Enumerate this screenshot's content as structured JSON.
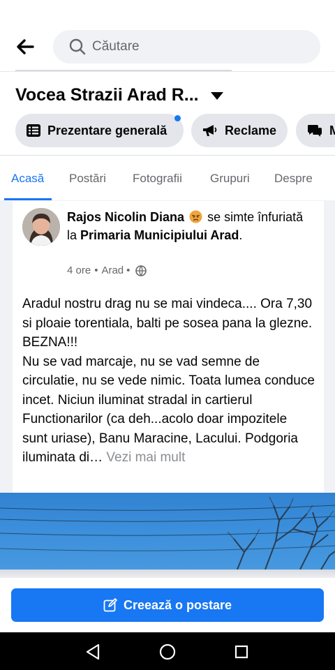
{
  "search": {
    "placeholder": "Căutare"
  },
  "page": {
    "title": "Vocea Strazii Arad R..."
  },
  "pills": [
    {
      "label": "Prezentare generală",
      "icon": "list-icon",
      "has_dot": true
    },
    {
      "label": "Reclame",
      "icon": "megaphone-icon"
    },
    {
      "label": "M",
      "icon": "chat-icon"
    }
  ],
  "tabs": [
    {
      "label": "Acasă",
      "active": true
    },
    {
      "label": "Postări"
    },
    {
      "label": "Fotografii"
    },
    {
      "label": "Grupuri"
    },
    {
      "label": "Despre"
    }
  ],
  "post": {
    "author": "Rajos Nicolin Diana",
    "feeling_text": "se simte înfuriată la",
    "place": "Primaria Municipiului Arad",
    "period": ".",
    "time": "4 ore",
    "location": "Arad",
    "separator": "•",
    "body": "Aradul nostru drag nu se mai vindeca.... Ora 7,30 si ploaie torentiala, balti pe sosea pana la glezne. BEZNA!!!\nNu se vad marcaje, nu se vad semne de circulatie, nu se vede nimic. Toata lumea conduce incet. Niciun iluminat stradal in cartierul Functionarilor (ca deh...acolo doar impozitele sunt uriase), Banu Maracine, Lacului. Podgoria iluminata di…",
    "see_more": "Vezi mai mult"
  },
  "create_post": {
    "label": "Creează o postare"
  },
  "colors": {
    "accent": "#1877f2",
    "pill_bg": "#e4e6eb",
    "feed_bg": "#f0f2f5",
    "muted_text": "#65676b"
  }
}
